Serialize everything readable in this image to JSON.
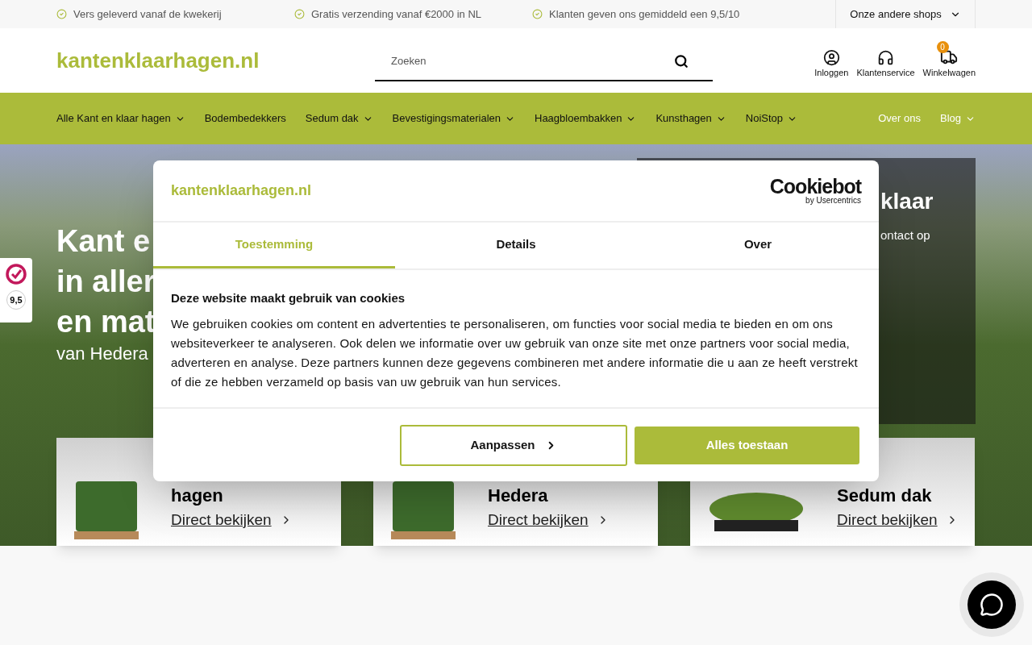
{
  "top_bar": {
    "usps": [
      "Vers geleverd vanaf de kwekerij",
      "Gratis verzending vanaf €2000 in NL",
      "Klanten geven ons gemiddeld een 9,5/10"
    ],
    "shops_menu": "Onze andere shops"
  },
  "header": {
    "logo": "kantenklaarhagen.nl",
    "search": {
      "placeholder": "Zoeken"
    },
    "actions": [
      {
        "kind": "account",
        "label": "Inloggen"
      },
      {
        "kind": "service",
        "label": "Klantenservice"
      },
      {
        "kind": "cart",
        "label": "Winkelwagen",
        "badge": "0"
      }
    ]
  },
  "nav": [
    {
      "label": "Alle Kant en klaar hagen",
      "dropdown": true,
      "kind": "main"
    },
    {
      "label": "Bodembedekkers",
      "dropdown": false,
      "kind": "main"
    },
    {
      "label": "Sedum dak",
      "dropdown": true,
      "kind": "main"
    },
    {
      "label": "Bevestigingsmaterialen",
      "dropdown": true,
      "kind": "main"
    },
    {
      "label": "Haagbloembakken",
      "dropdown": true,
      "kind": "main"
    },
    {
      "label": "Kunsthagen",
      "dropdown": true,
      "kind": "main"
    },
    {
      "label": "NoiStop",
      "dropdown": true,
      "kind": "main"
    },
    {
      "label": "Over ons",
      "dropdown": false,
      "kind": "secondary"
    },
    {
      "label": "Blog",
      "dropdown": true,
      "kind": "secondary"
    }
  ],
  "hero": {
    "lines": [
      "Kant e",
      "in aller",
      "en mat"
    ],
    "subtitle": "van Hedera",
    "side_title": "klaar",
    "side_text": "ontact op"
  },
  "rating_badge": {
    "score": "9,5"
  },
  "cards": [
    {
      "title": "hagen",
      "link": "Direct bekijken",
      "kind": "hedge"
    },
    {
      "title": "Hedera",
      "link": "Direct bekijken",
      "kind": "hedge"
    },
    {
      "title": "Sedum dak",
      "link": "Direct bekijken",
      "kind": "sedum"
    }
  ],
  "cookie_dialog": {
    "logo": "kantenklaarhagen.nl",
    "brand": "Cookiebot",
    "brand_sub": "by Usercentrics",
    "tabs": [
      {
        "label": "Toestemming",
        "selected": true
      },
      {
        "label": "Details",
        "selected": false
      },
      {
        "label": "Over",
        "selected": false
      }
    ],
    "heading": "Deze website maakt gebruik van cookies",
    "body": "We gebruiken cookies om content en advertenties te personaliseren, om functies voor social media te bieden en om ons websiteverkeer te analyseren. Ook delen we informatie over uw gebruik van onze site met onze partners voor social media, adverteren en analyse. Deze partners kunnen deze gegevens combineren met andere informatie die u aan ze heeft verstrekt of die ze hebben verzameld op basis van uw gebruik van hun services.",
    "buttons": [
      {
        "label": "Aanpassen",
        "kind": "outline"
      },
      {
        "label": "Alles toestaan",
        "kind": "primary"
      }
    ]
  }
}
